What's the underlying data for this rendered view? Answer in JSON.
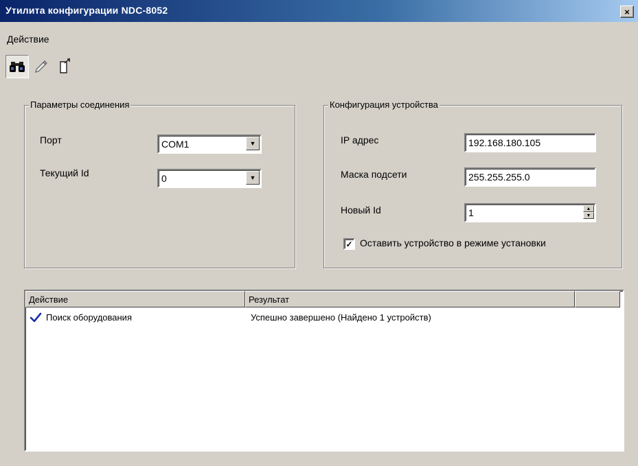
{
  "window": {
    "title": "Утилита конфигурации NDC-8052",
    "close_label": "×"
  },
  "menu": {
    "items": [
      {
        "label": "Действие"
      }
    ]
  },
  "toolbar": {
    "buttons": [
      {
        "icon": "binoculars-icon"
      },
      {
        "icon": "pencil-icon"
      },
      {
        "icon": "export-icon"
      }
    ]
  },
  "connection": {
    "legend": "Параметры соединения",
    "port_label": "Порт",
    "port_value": "COM1",
    "current_id_label": "Текущий Id",
    "current_id_value": "0"
  },
  "device": {
    "legend": "Конфигурация устройства",
    "ip_label": "IP адрес",
    "ip_value": "192.168.180.105",
    "mask_label": "Маска подсети",
    "mask_value": "255.255.255.0",
    "new_id_label": "Новый Id",
    "new_id_value": "1",
    "keep_setup_label": "Оставить устройство в режиме установки",
    "keep_setup_checked": true
  },
  "log": {
    "columns": [
      "Действие",
      "Результат",
      ""
    ],
    "rows": [
      {
        "status_icon": "checkmark-icon",
        "action": "Поиск оборудования",
        "result": "Успешно завершено (Найдено 1 устройств)"
      }
    ]
  }
}
